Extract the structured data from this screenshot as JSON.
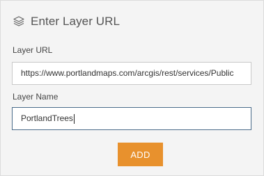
{
  "dialog": {
    "title": "Enter Layer URL",
    "icon": "layers-icon"
  },
  "layer_url": {
    "label": "Layer URL",
    "value": "https://www.portlandmaps.com/arcgis/rest/services/Public"
  },
  "layer_name": {
    "label": "Layer Name",
    "value": "PortlandTrees"
  },
  "actions": {
    "add_label": "ADD",
    "add_color": "#e8912d"
  }
}
